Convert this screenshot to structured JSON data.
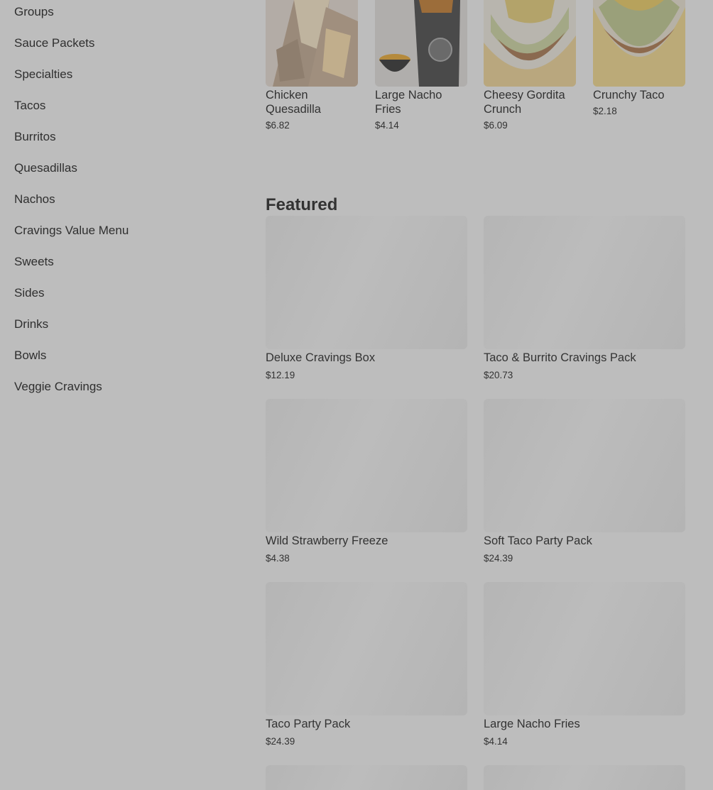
{
  "sidebar": {
    "categories": [
      "Groups",
      "Sauce Packets",
      "Specialties",
      "Tacos",
      "Burritos",
      "Quesadillas",
      "Nachos",
      "Cravings Value Menu",
      "Sweets",
      "Sides",
      "Drinks",
      "Bowls",
      "Veggie Cravings"
    ]
  },
  "top_items": [
    {
      "name": "Chicken Quesadilla",
      "price": "$6.82"
    },
    {
      "name": "Large Nacho Fries",
      "price": "$4.14"
    },
    {
      "name": "Cheesy Gordita Crunch",
      "price": "$6.09"
    },
    {
      "name": "Crunchy Taco",
      "price": "$2.18"
    }
  ],
  "featured": {
    "title": "Featured",
    "items": [
      {
        "name": "Deluxe Cravings Box",
        "price": "$12.19"
      },
      {
        "name": "Taco & Burrito Cravings Pack",
        "price": "$20.73"
      },
      {
        "name": "Wild Strawberry Freeze",
        "price": "$4.38"
      },
      {
        "name": "Soft Taco Party Pack",
        "price": "$24.39"
      },
      {
        "name": "Taco Party Pack",
        "price": "$24.39"
      },
      {
        "name": "Large Nacho Fries",
        "price": "$4.14"
      }
    ]
  },
  "colors": {
    "overlay_background": "#bdbdbd",
    "placeholder": "#b8b8b8",
    "text": "#2f2f2f"
  }
}
